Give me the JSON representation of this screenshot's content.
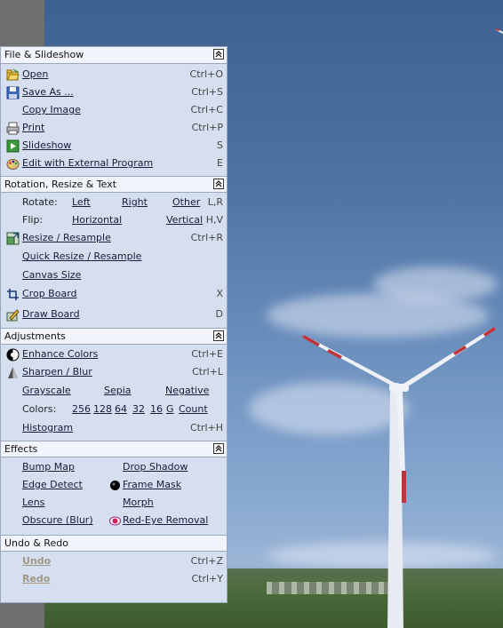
{
  "file_slideshow": {
    "title": "File & Slideshow",
    "items": [
      {
        "label": "Open",
        "shortcut": "Ctrl+O",
        "icon": "open-folder-icon"
      },
      {
        "label": "Save As ...",
        "shortcut": "Ctrl+S",
        "icon": "save-disk-icon"
      },
      {
        "label": "Copy Image",
        "shortcut": "Ctrl+C"
      },
      {
        "label": "Print",
        "shortcut": "Ctrl+P",
        "icon": "printer-icon"
      },
      {
        "label": "Slideshow",
        "shortcut": "S",
        "icon": "slideshow-icon"
      },
      {
        "label": "Edit with External Program",
        "shortcut": "E",
        "icon": "palette-icon"
      }
    ]
  },
  "rotation": {
    "title": "Rotation, Resize & Text",
    "rotate": {
      "lead": "Rotate:",
      "left": "Left",
      "right": "Right",
      "other": "Other",
      "shortcut": "L,R"
    },
    "flip": {
      "lead": "Flip:",
      "horizontal": "Horizontal",
      "vertical": "Vertical",
      "shortcut": "H,V"
    },
    "resize": {
      "label": "Resize / Resample",
      "shortcut": "Ctrl+R"
    },
    "quick_resize": "Quick Resize / Resample",
    "canvas_size": "Canvas Size",
    "crop": {
      "label": "Crop Board",
      "shortcut": "X"
    },
    "draw": {
      "label": "Draw Board",
      "shortcut": "D"
    }
  },
  "adjustments": {
    "title": "Adjustments",
    "enhance": {
      "label": "Enhance Colors",
      "shortcut": "Ctrl+E"
    },
    "sharpen": {
      "label": "Sharpen / Blur",
      "shortcut": "Ctrl+L"
    },
    "grayscale": "Grayscale",
    "sepia": "Sepia",
    "negative": "Negative",
    "colors": {
      "lead": "Colors:",
      "options": [
        "256",
        "128",
        "64",
        "32",
        "16",
        "G",
        "Count"
      ]
    },
    "histogram": {
      "label": "Histogram",
      "shortcut": "Ctrl+H"
    }
  },
  "effects": {
    "title": "Effects",
    "bump_map": "Bump Map",
    "drop_shadow": "Drop Shadow",
    "edge_detect": "Edge Detect",
    "frame_mask": "Frame Mask",
    "lens": "Lens",
    "morph": "Morph",
    "obscure": "Obscure (Blur)",
    "red_eye": "Red-Eye Removal"
  },
  "undo_redo": {
    "title": "Undo & Redo",
    "undo": {
      "label": "Undo",
      "shortcut": "Ctrl+Z"
    },
    "redo": {
      "label": "Redo",
      "shortcut": "Ctrl+Y"
    }
  },
  "colors": {
    "panel_bg": "#d6dfef",
    "header_bg": "#f1f4fa",
    "border": "#9aa7c0",
    "disabled_text": "#a09880"
  }
}
